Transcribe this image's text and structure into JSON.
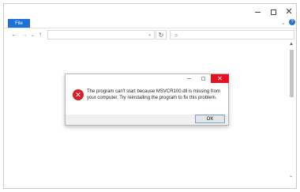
{
  "window": {
    "controls": {
      "minimize": "—",
      "maximize": "☐",
      "close": "✕"
    }
  },
  "ribbon": {
    "file_tab": "File",
    "expand_icon": "chevron-down-icon",
    "help_icon": "help-icon",
    "accent_color": "#1a73d4"
  },
  "navigation": {
    "back_icon": "arrow-left-icon",
    "forward_icon": "arrow-right-icon",
    "recent_icon": "chevron-down-icon",
    "up_icon": "arrow-up-icon",
    "address_value": "",
    "refresh_icon": "refresh-icon",
    "search_placeholder": "",
    "search_icon": "search-icon"
  },
  "dialog": {
    "message": "The program can't start because MSVCR100.dll is missing from your computer. Try reinstalling the program to fix this problem.",
    "ok_label": "OK",
    "error_icon": "error-icon",
    "close_color": "#e81123"
  }
}
